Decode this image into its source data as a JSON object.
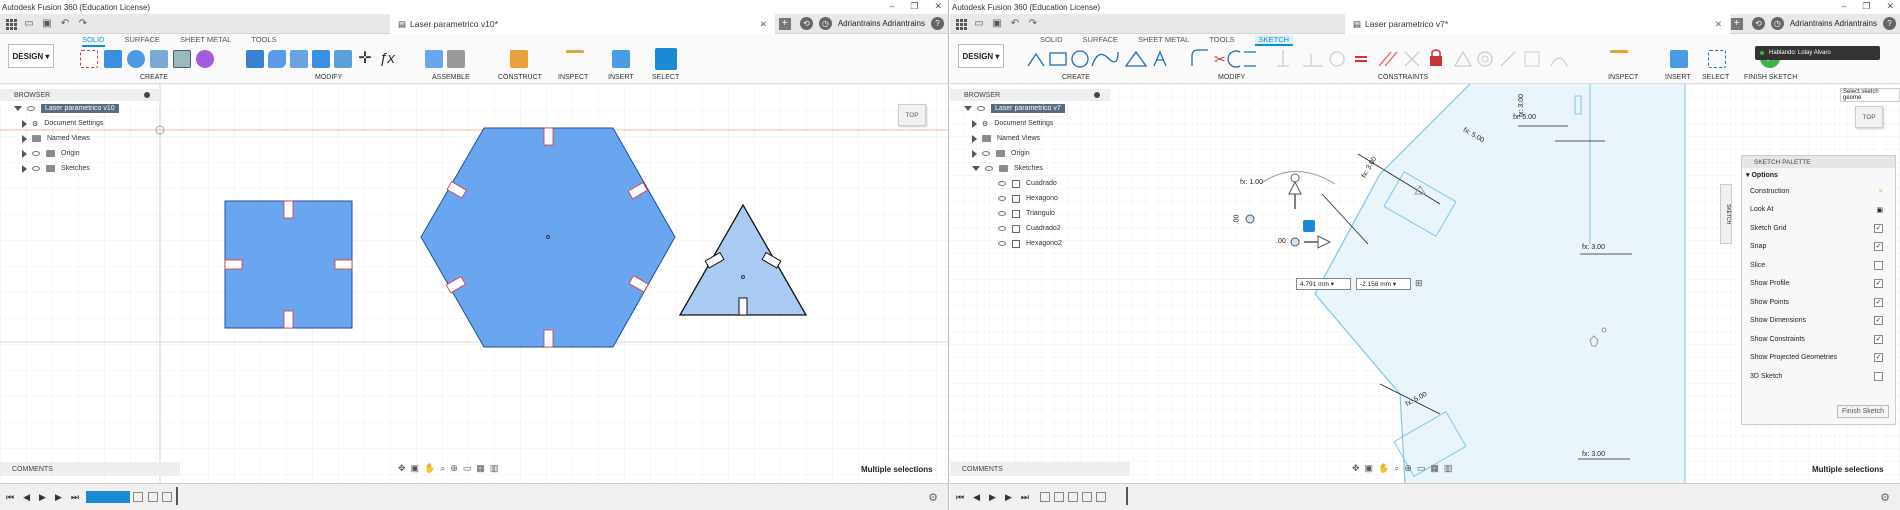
{
  "left": {
    "title": "Autodesk Fusion 360 (Education License)",
    "doc_tab": "Laser parametrico v10*",
    "user": "Adriantrains Adriantrains",
    "design_label": "DESIGN",
    "ws_tabs": [
      "SOLID",
      "SURFACE",
      "SHEET METAL",
      "TOOLS"
    ],
    "groups": [
      "CREATE",
      "MODIFY",
      "ASSEMBLE",
      "CONSTRUCT",
      "INSPECT",
      "INSERT",
      "SELECT"
    ],
    "browser_label": "BROWSER",
    "root": "Laser parametrico v10",
    "tree": [
      "Document Settings",
      "Named Views",
      "Origin",
      "Sketches"
    ],
    "comments": "COMMENTS",
    "status": "Multiple selections",
    "viewcube": "TOP"
  },
  "right": {
    "title": "Autodesk Fusion 360 (Education License)",
    "doc_tab": "Laser parametrico v7*",
    "user": "Adriantrains Adriantrains",
    "design_label": "DESIGN",
    "ws_tabs": [
      "SOLID",
      "SURFACE",
      "SHEET METAL",
      "TOOLS",
      "SKETCH"
    ],
    "groups": [
      "CREATE",
      "MODIFY",
      "CONSTRAINTS",
      "INSPECT",
      "INSERT",
      "SELECT",
      "FINISH SKETCH"
    ],
    "browser_label": "BROWSER",
    "root": "Laser parametrico v7",
    "tree": [
      "Document Settings",
      "Named Views",
      "Origin",
      "Sketches"
    ],
    "sketches": [
      "Cuadrado",
      "Hexagono",
      "Triangulo",
      "Cuadrado2",
      "Hexagono2"
    ],
    "comments": "COMMENTS",
    "status": "Multiple selections",
    "viewcube": "TOP",
    "toast": "Hablando: Lolay Alvaro",
    "tooltip": "Select sketch geome",
    "dim_x": "4.791 mm",
    "dim_y": "-2.158 mm",
    "dims": [
      "fx: 5.00",
      "fx: 3.00",
      "fx: 1.00",
      "fx: 5.00",
      "fx: 3.00",
      "fx: 3.00",
      "fx: 5.00",
      "fx: 3.00"
    ],
    "side_tab": "SKETCH",
    "palette": {
      "title": "SKETCH PALETTE",
      "section": "Options",
      "rows": [
        "Construction",
        "Look At",
        "Sketch Grid",
        "Snap",
        "Slice",
        "Show Profile",
        "Show Points",
        "Show Dimensions",
        "Show Constraints",
        "Show Projected Geometries",
        "3D Sketch"
      ],
      "finish": "Finish Sketch"
    }
  },
  "colors": {
    "accent": "#0696d7",
    "body_blue": "#6aa6f0",
    "profile_blue": "#a9cbf3"
  }
}
